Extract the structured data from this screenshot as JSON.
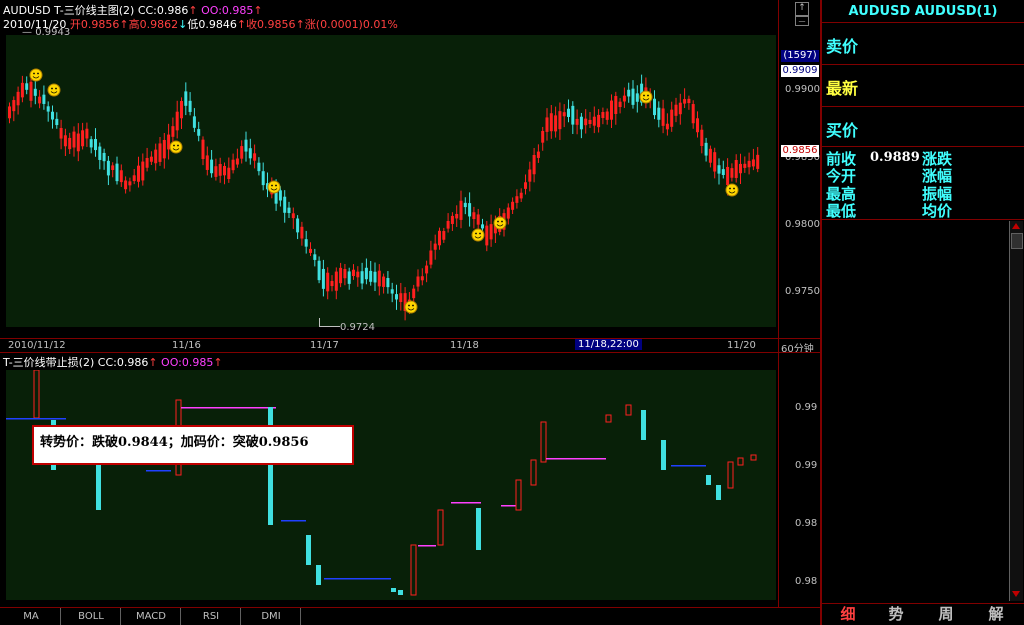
{
  "main_chart": {
    "title": "AUDUSD T-三价线主图(2)",
    "cc": "CC:0.986",
    "cc_up": "↑",
    "oo": "OO:0.985",
    "oo_up": "↑",
    "info_line": {
      "date": "2010/11/20",
      "open": "开0.9856",
      "open_arrow": "↑",
      "high": "高0.9862",
      "high_arrow": "↑",
      "low": "低0.9846",
      "low_arrow": "↓",
      "close": "收0.9856",
      "close_arrow": "↑",
      "change": "涨(0.0001)0.01%"
    },
    "top_value": "0.9943",
    "bottom_value": "0.9724",
    "y_ticks": [
      "0.9900",
      "0.9850",
      "0.9800",
      "0.9750"
    ],
    "count_badge": "(1597)",
    "current_badge": "0.9909",
    "price_badge": "0.9856",
    "x_labels": [
      "2010/11/12",
      "11/16",
      "11/17",
      "11/18",
      "11/18,22:00",
      "11/20"
    ],
    "period": "60分钟"
  },
  "sub_chart": {
    "title": "T-三价线带止损(2)",
    "cc": "CC:0.986",
    "cc_up": "↑",
    "oo": "OO:0.985",
    "oo_up": "↑",
    "y_ticks": [
      "0.99",
      "0.99",
      "0.98",
      "0.98"
    ],
    "annotation": "转势价：跌破0.9844；加码价：突破0.9856"
  },
  "right_panel": {
    "header": "AUDUSD AUDUSD(1)",
    "sell": "卖价",
    "latest": "最新",
    "buy": "买价",
    "prev_close": "前收",
    "prev_close_value": "0.9889",
    "change_label": "涨跌",
    "open_label": "今开",
    "change_pct_label": "涨幅",
    "high_label": "最高",
    "amplitude_label": "振幅",
    "low_label": "最低",
    "avg_label": "均价",
    "tabs": [
      "细",
      "势",
      "周",
      "解"
    ]
  },
  "bottom_tabs": [
    "MA",
    "BOLL",
    "MACD",
    "RSI",
    "DMI"
  ],
  "chart_data": {
    "type": "candlestick",
    "ylim": [
      0.9724,
      0.9943
    ],
    "marker_label": "smiley"
  },
  "colors": {
    "up": "#ff2020",
    "down": "#40e0e0",
    "plot_bg": "#082008",
    "border": "#800000",
    "accent": "#40ffff"
  }
}
